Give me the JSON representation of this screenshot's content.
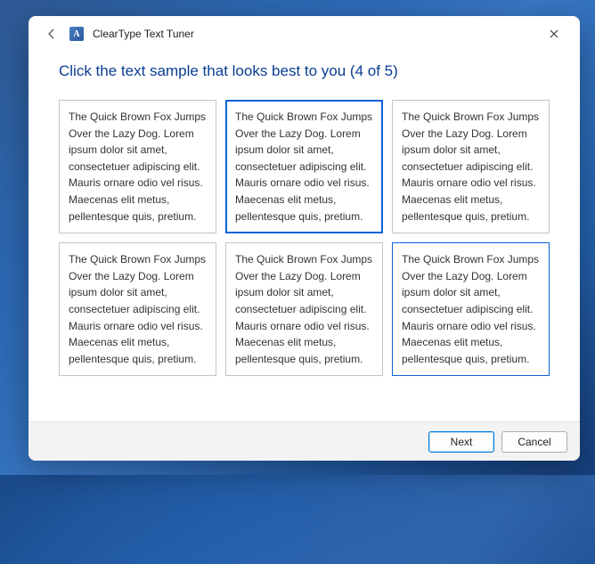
{
  "titlebar": {
    "title": "ClearType Text Tuner",
    "app_icon_letter": "A"
  },
  "heading": "Click the text sample that looks best to you (4 of 5)",
  "sample_text": "The Quick Brown Fox Jumps Over the Lazy Dog. Lorem ipsum dolor sit amet, consectetuer adipiscing elit. Mauris ornare odio vel risus. Maecenas elit metus, pellentesque quis, pretium.",
  "buttons": {
    "next": "Next",
    "cancel": "Cancel"
  },
  "state": {
    "selected_index": 1,
    "hover_index": 5
  }
}
